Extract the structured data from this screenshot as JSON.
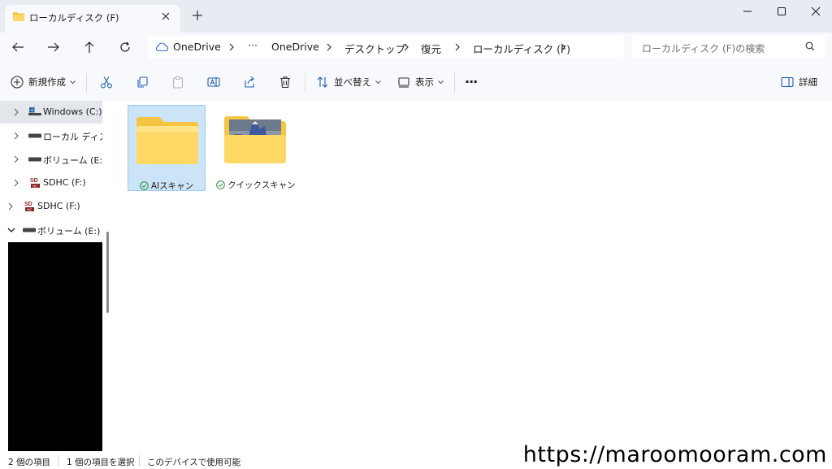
{
  "window": {
    "tab_title": "ローカルディスク (F)",
    "new_tab_icon": "plus-icon",
    "controls": [
      "minimize-icon",
      "maximize-icon",
      "close-icon"
    ]
  },
  "address": {
    "crumbs": [
      "OneDrive",
      "OneDrive",
      "デスクトップ",
      "復元",
      "ローカルディスク (F)"
    ],
    "overflow": "···",
    "search_placeholder": "ローカルディスク (F)の検索"
  },
  "toolbar": {
    "new_label": "新規作成",
    "sort_label": "並べ替え",
    "view_label": "表示",
    "more_label": "···",
    "details_label": "詳細"
  },
  "nav": {
    "items": [
      {
        "label": "Windows (C:)"
      },
      {
        "label": "ローカル ディスク (D:)"
      },
      {
        "label": "ボリューム (E:)"
      },
      {
        "label": "SDHC (F:)"
      },
      {
        "label": "SDHC (F:)"
      },
      {
        "label": "ボリューム (E:)"
      }
    ]
  },
  "content": {
    "items": [
      {
        "label": "AIスキャン",
        "status": "available"
      },
      {
        "label": "クイックスキャン",
        "status": "available"
      }
    ]
  },
  "status": {
    "count": "2 個の項目",
    "selected": "1 個の項目を選択",
    "availability": "このデバイスで使用可能"
  },
  "watermark": "https://maroomooram.com",
  "colors": {
    "folder": "#f5c542",
    "selection_bg": "#cce4f7",
    "onedrive_blue": "#2f74c7",
    "sync_green": "#2a8c3b"
  }
}
